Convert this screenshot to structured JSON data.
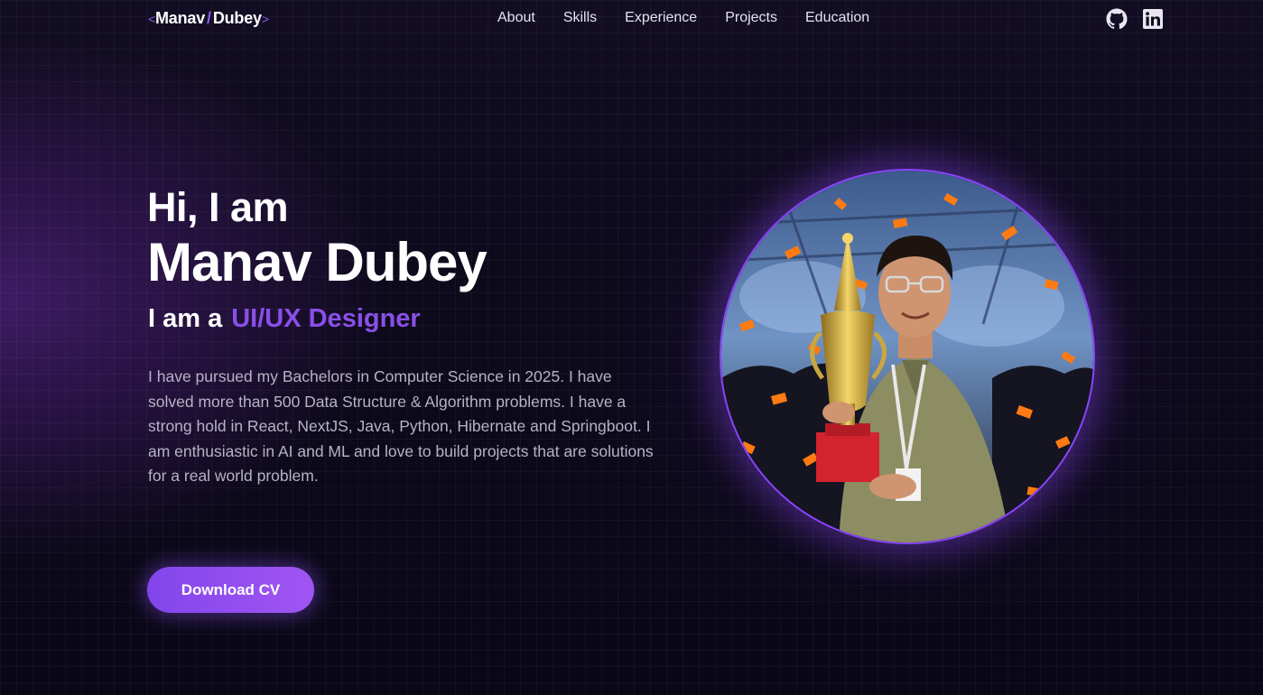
{
  "nav": {
    "logo": {
      "open": "<",
      "first": "Manav",
      "slash": "/",
      "last": "Dubey",
      "close": ">"
    },
    "links": [
      "About",
      "Skills",
      "Experience",
      "Projects",
      "Education"
    ],
    "social_icons": [
      "github-icon",
      "linkedin-icon"
    ]
  },
  "hero": {
    "greeting": "Hi, I am",
    "name": "Manav Dubey",
    "role_prefix": "I am a",
    "role": "UI/UX Designer",
    "bio": "I have pursued my Bachelors in Computer Science in 2025. I have solved more than 500 Data Structure & Algorithm problems. I have a strong hold in React, NextJS, Java, Python, Hibernate and Springboot. I am enthusiastic in AI and ML and love to build projects that are solutions for a real world problem.",
    "cta": "Download CV"
  },
  "colors": {
    "background": "#0b0819",
    "accent": "#8a4fe8",
    "button_start": "#8246ec",
    "button_end": "#a155f2"
  }
}
